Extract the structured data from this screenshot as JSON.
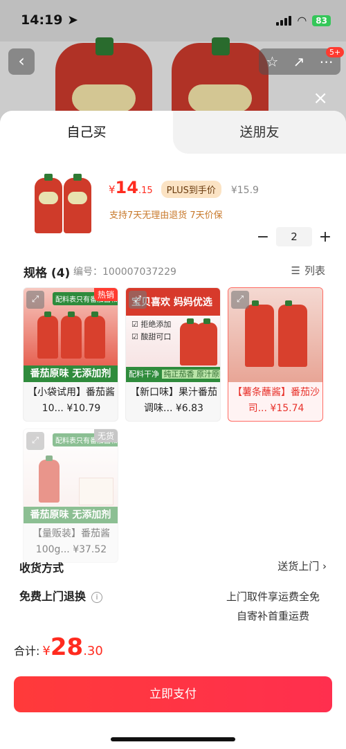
{
  "status": {
    "time": "14:19",
    "battery": "83"
  },
  "nav": {
    "back_icon": "chevron-left-icon",
    "badge": "5+"
  },
  "tabs": [
    {
      "label": "自己买"
    },
    {
      "label": "送朋友"
    }
  ],
  "product": {
    "price_symbol": "¥",
    "price_int": "14",
    "price_dec": ".15",
    "plus_tag": "PLUS到手价",
    "original_price": "¥15.9",
    "guarantee": "支持7天无理由退货  7天价保",
    "quantity": "2"
  },
  "spec": {
    "title": "规格 (4)",
    "code": "编号：100007037229",
    "list_label": "列表"
  },
  "options": [
    {
      "name": "【小袋试用】番茄酱10...",
      "price": "¥10.79",
      "badge": "热销",
      "top_banner": "配料表只有番茄酱和水",
      "bottom_banner": "番茄原味 无添加剂",
      "selected": false,
      "soldout": false
    },
    {
      "name": "【新口味】果汁番茄调味...",
      "price": "¥6.83",
      "banner": "宝贝喜欢  妈妈优选",
      "checks": [
        "拒绝添加",
        "酸甜可口"
      ],
      "bottom_left": "配料干净",
      "bottom_hl": "纯正茄香 原汁原味",
      "selected": false,
      "soldout": false
    },
    {
      "name": "【薯条蘸酱】番茄沙司...",
      "price": "¥15.74",
      "selected": true,
      "soldout": false
    },
    {
      "name": "【量贩装】番茄酱100g...",
      "price": "¥37.52",
      "badge": "无货",
      "top_banner": "配料表只有番茄酱和水",
      "bottom_banner": "番茄原味 无添加剂",
      "selected": false,
      "soldout": true
    }
  ],
  "delivery": {
    "label": "收货方式",
    "value": "送货上门"
  },
  "returns": {
    "label": "免费上门退换",
    "value_line1": "上门取件享运费全免",
    "value_line2": "自寄补首重运费"
  },
  "footer": {
    "total_label": "合计:",
    "total_symbol": "¥",
    "total_int": "28",
    "total_dec": ".30",
    "pay_label": "立即支付"
  },
  "colors": {
    "accent": "#ff2b1f",
    "plus_bg": "#fbe3c4",
    "guarantee": "#c8792b",
    "green_banner": "#2f8b3c"
  }
}
